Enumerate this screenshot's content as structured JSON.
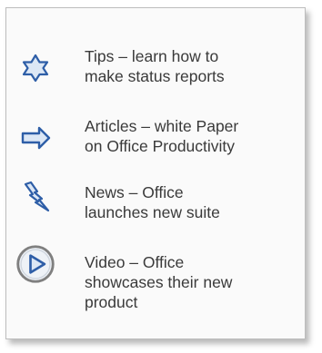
{
  "items": [
    {
      "icon": "star-icon",
      "text": "Tips – learn how to\nmake status reports"
    },
    {
      "icon": "arrow-right-icon",
      "text": "Articles – white Paper\non  Office Productivity"
    },
    {
      "icon": "lightning-icon",
      "text": "News – Office\nlaunches new suite"
    },
    {
      "icon": "play-icon",
      "text": "Video – Office\nshowcases their new\nproduct"
    }
  ],
  "colors": {
    "icon_fill": "#dce7f5",
    "icon_stroke": "#2e5ea7",
    "play_ring": "#7f7f7f",
    "text": "#3a3a3a"
  }
}
